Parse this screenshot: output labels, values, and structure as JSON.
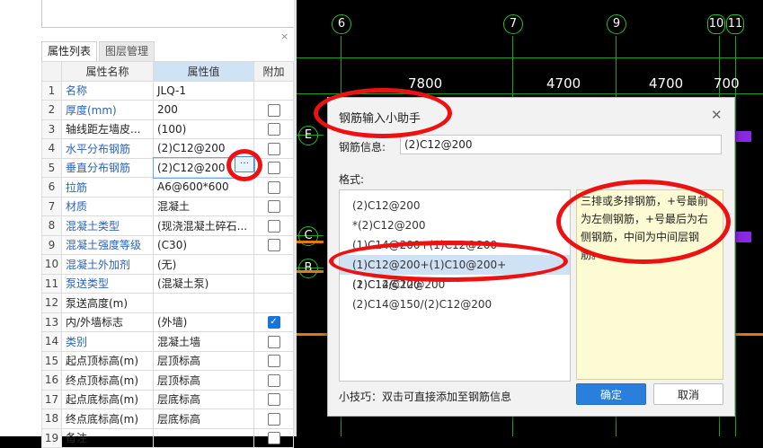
{
  "left_panel": {
    "tabs": {
      "properties": "属性列表",
      "layers": "图层管理"
    },
    "close_glyph": "×",
    "columns": {
      "name": "属性名称",
      "value": "属性值",
      "extra": "附加"
    },
    "rows": [
      {
        "idx": "1",
        "name": "名称",
        "value": "JLQ-1",
        "link": true,
        "checkbox": "none"
      },
      {
        "idx": "2",
        "name": "厚度(mm)",
        "value": "200",
        "link": true,
        "checkbox": "off"
      },
      {
        "idx": "3",
        "name": "轴线距左墙皮...",
        "value": "(100)",
        "link": false,
        "checkbox": "off"
      },
      {
        "idx": "4",
        "name": "水平分布钢筋",
        "value": "(2)C12@200",
        "link": true,
        "checkbox": "off"
      },
      {
        "idx": "5",
        "name": "垂直分布钢筋",
        "value": "(2)C12@200",
        "link": true,
        "checkbox": "off",
        "selected": true
      },
      {
        "idx": "6",
        "name": "拉筋",
        "value": "A6@600*600",
        "link": true,
        "checkbox": "off"
      },
      {
        "idx": "7",
        "name": "材质",
        "value": "混凝土",
        "link": true,
        "checkbox": "off"
      },
      {
        "idx": "8",
        "name": "混凝土类型",
        "value": "(现浇混凝土碎石...",
        "link": true,
        "checkbox": "off"
      },
      {
        "idx": "9",
        "name": "混凝土强度等级",
        "value": "(C30)",
        "link": true,
        "checkbox": "off"
      },
      {
        "idx": "10",
        "name": "混凝土外加剂",
        "value": "(无)",
        "link": true,
        "checkbox": "none"
      },
      {
        "idx": "11",
        "name": "泵送类型",
        "value": "(混凝土泵)",
        "link": true,
        "checkbox": "none"
      },
      {
        "idx": "12",
        "name": "泵送高度(m)",
        "value": "",
        "link": false,
        "checkbox": "none"
      },
      {
        "idx": "13",
        "name": "内/外墙标志",
        "value": "(外墙)",
        "link": false,
        "checkbox": "on"
      },
      {
        "idx": "14",
        "name": "类别",
        "value": "混凝土墙",
        "link": true,
        "checkbox": "off"
      },
      {
        "idx": "15",
        "name": "起点顶标高(m)",
        "value": "层顶标高",
        "link": false,
        "checkbox": "off"
      },
      {
        "idx": "16",
        "name": "终点顶标高(m)",
        "value": "层顶标高",
        "link": false,
        "checkbox": "off"
      },
      {
        "idx": "17",
        "name": "起点底标高(m)",
        "value": "层底标高",
        "link": false,
        "checkbox": "off"
      },
      {
        "idx": "18",
        "name": "终点底标高(m)",
        "value": "层底标高",
        "link": false,
        "checkbox": "off"
      },
      {
        "idx": "19",
        "name": "备注",
        "value": "",
        "link": false,
        "checkbox": "off"
      }
    ],
    "ellipsis_glyph": "···"
  },
  "cad": {
    "axes_top": [
      "6",
      "7",
      "9",
      "10",
      "11"
    ],
    "axes_left": [
      "E",
      "C",
      "B"
    ],
    "dimensions": [
      "7800",
      "4700",
      "4700",
      "700"
    ],
    "line_color": "#1aa21a",
    "wall_color_purple": "#8a2be2",
    "wall_color_orange": "#e07a10"
  },
  "dialog": {
    "title": "钢筋输入小助手",
    "close_glyph": "✕",
    "info_label": "钢筋信息:",
    "info_value": "(2)C12@200",
    "format_label": "格式:",
    "formats": [
      "(2)C12@200",
      "*(2)C12@200",
      "(1)C14@200+(1)C12@200",
      "(1)C12@200+(1)C10@200+(1)C12@200",
      "(2)C14/C12@200",
      "(2)C14@150/(2)C12@200"
    ],
    "selected_index": 3,
    "hint": "三排或多排钢筋，+号最前为左侧钢筋，+号最后为右侧钢筋，中间为中间层钢筋。",
    "tip": "小技巧：双击可直接添加至钢筋信息",
    "ok_label": "确定",
    "cancel_label": "取消",
    "accent_color": "#2b7fdc"
  },
  "annotation_color": "#e11111"
}
